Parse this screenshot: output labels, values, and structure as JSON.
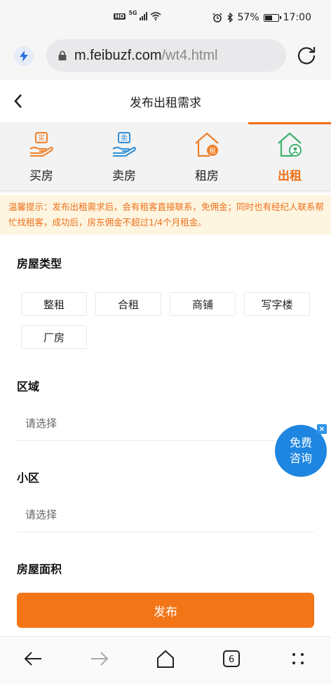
{
  "status_bar": {
    "hd_badge": "HD",
    "network": "5G",
    "battery_percent": "57%",
    "battery_level": 0.57,
    "time": "17:00",
    "icons": [
      "alarm-icon",
      "bluetooth-icon",
      "battery-icon",
      "wifi-icon",
      "signal-icon"
    ]
  },
  "browser": {
    "url_host": "m.feibuzf.com",
    "url_path": "/wt4.html"
  },
  "header": {
    "title": "发布出租需求"
  },
  "tabs": [
    {
      "label": "买房",
      "icon": "buy-house-icon",
      "color": "#f0812a",
      "active": false
    },
    {
      "label": "卖房",
      "icon": "sell-house-icon",
      "color": "#2f8fd8",
      "active": false
    },
    {
      "label": "租房",
      "icon": "rent-house-icon",
      "color": "#f0812a",
      "active": false
    },
    {
      "label": "出租",
      "icon": "let-house-icon",
      "color": "#3fb070",
      "active": true
    }
  ],
  "notice": {
    "text": "温馨提示：发布出租需求后，会有租客直接联系，免佣金；同时也有经纪人联系帮忙找租客，成功后，房东佣金不超过1/4个月租金。"
  },
  "form": {
    "house_type": {
      "label": "房屋类型",
      "options": [
        "整租",
        "合租",
        "商铺",
        "写字楼",
        "厂房"
      ]
    },
    "district": {
      "label": "区域",
      "placeholder": "请选择"
    },
    "community": {
      "label": "小区",
      "placeholder": "请选择"
    },
    "area": {
      "label": "房屋面积"
    }
  },
  "consult": {
    "line1": "免费",
    "line2": "咨询",
    "close": "×"
  },
  "publish_button": "发布",
  "navbar": {
    "tab_count": "6"
  },
  "colors": {
    "accent": "#f27618",
    "consult_blue": "#1e86e0",
    "notice_bg": "#fdf5e0"
  }
}
